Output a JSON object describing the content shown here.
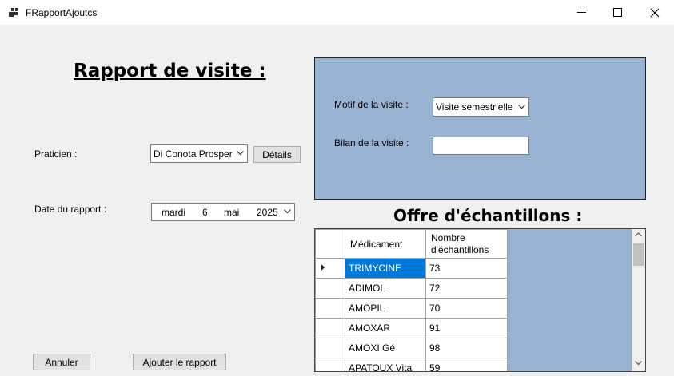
{
  "window": {
    "title": "FRapportAjoutcs"
  },
  "form": {
    "heading": "Rapport de visite :",
    "praticien_label": "Praticien :",
    "praticien_value": "Di Conota Prosper",
    "details_button": "Détails",
    "date_label": "Date du rapport :",
    "date": {
      "weekday": "mardi",
      "day": "6",
      "month": "mai",
      "year": "2025"
    }
  },
  "visite": {
    "motif_label": "Motif de la visite :",
    "motif_value": "Visite semestrielle",
    "bilan_label": "Bilan de la visite :",
    "bilan_value": ""
  },
  "offre": {
    "heading": "Offre d'échantillons :",
    "columns": [
      "Médicament",
      "Nombre d'échantillons"
    ],
    "rows": [
      {
        "medicament": "TRIMYCINE",
        "nombre": "73"
      },
      {
        "medicament": "ADIMOL",
        "nombre": "72"
      },
      {
        "medicament": "AMOPIL",
        "nombre": "70"
      },
      {
        "medicament": "AMOXAR",
        "nombre": "91"
      },
      {
        "medicament": "AMOXI Gé",
        "nombre": "98"
      },
      {
        "medicament": "APATOUX Vita",
        "nombre": "59"
      }
    ]
  },
  "actions": {
    "cancel": "Annuler",
    "add": "Ajouter le rapport"
  },
  "colors": {
    "panel": "#98b3d2",
    "selection": "#0078d7"
  }
}
